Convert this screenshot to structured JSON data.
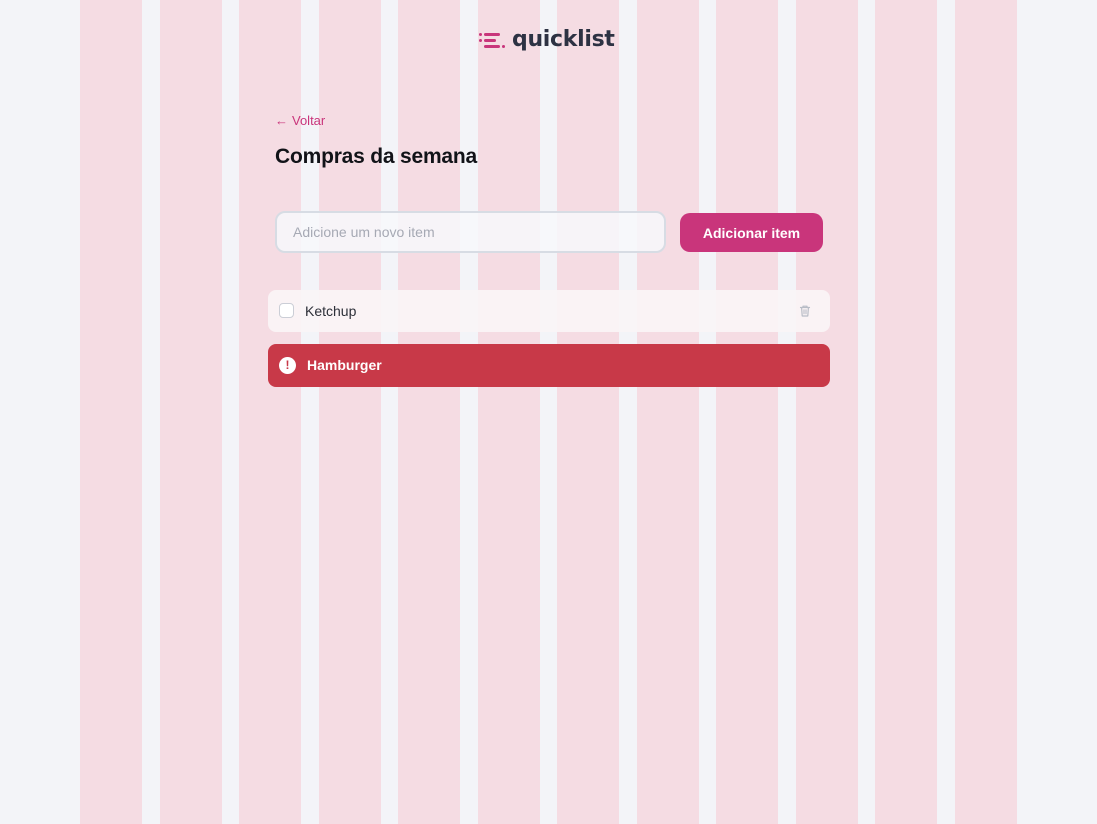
{
  "brand": {
    "name": "quicklist",
    "accent_color": "#C9357B",
    "text_color": "#2D3243",
    "logo_icon": "list-lines-icon"
  },
  "nav": {
    "back_arrow": "←",
    "back_label": "Voltar"
  },
  "page": {
    "title": "Compras da semana"
  },
  "form": {
    "input_placeholder": "Adicione um novo item",
    "input_value": "",
    "add_button_label": "Adicionar item"
  },
  "list": {
    "items": [
      {
        "label": "Ketchup",
        "checked": false,
        "delete_icon": "trash-icon"
      }
    ]
  },
  "alert": {
    "text": "Hamburger",
    "icon": "exclamation-icon",
    "icon_glyph": "!",
    "background_color": "#C83948"
  },
  "grid_overlay": {
    "column_color": "#F5DCE3"
  }
}
